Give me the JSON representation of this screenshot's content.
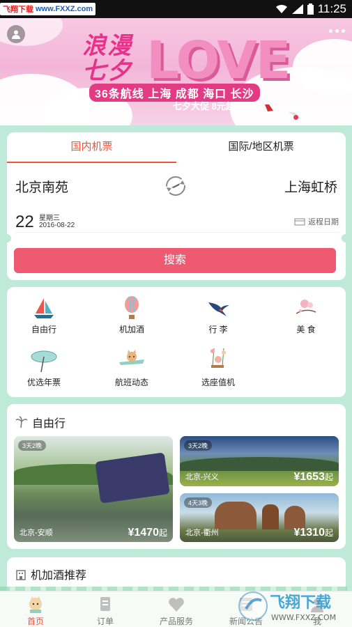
{
  "status_bar": {
    "site_left": "飞翔下载",
    "site_right": "www.FXXZ.com",
    "time": "11:25"
  },
  "banner": {
    "line1": "浪漫",
    "line2": "七夕",
    "big": "LOVE",
    "routes": "36条航线 上海 成都 海口 长沙",
    "promo": "七夕大促 8元起",
    "slide_count": 6,
    "active_slide": 0
  },
  "flight": {
    "tabs": [
      {
        "label": "国内机票",
        "active": true
      },
      {
        "label": "国际/地区机票",
        "active": false
      }
    ],
    "from": "北京南苑",
    "to": "上海虹桥",
    "day": "22",
    "weekday": "星期三",
    "date": "2016-08-22",
    "return_label": "返程日期",
    "search_label": "搜索"
  },
  "categories": [
    {
      "label": "自由行",
      "icon": "sailboat-icon"
    },
    {
      "label": "机加酒",
      "icon": "hot-air-balloon-icon"
    },
    {
      "label": "行 李",
      "icon": "swallow-icon"
    },
    {
      "label": "美 食",
      "icon": "flower-icon"
    },
    {
      "label": "优选年票",
      "icon": "umbrella-icon"
    },
    {
      "label": "航班动态",
      "icon": "plane-cat-icon"
    },
    {
      "label": "选座值机",
      "icon": "swing-icon"
    }
  ],
  "travel": {
    "title": "自由行",
    "tiles": [
      {
        "badge": "3天2晚",
        "city": "北京-安顺",
        "price": "¥1470",
        "suffix": "起"
      },
      {
        "badge": "3天2晚",
        "city": "北京-兴义",
        "price": "¥1653",
        "suffix": "起"
      },
      {
        "badge": "4天3晚",
        "city": "北京-衢州",
        "price": "¥1310",
        "suffix": "起"
      }
    ]
  },
  "hotel": {
    "title": "机加酒推荐"
  },
  "tabbar": [
    {
      "label": "首页",
      "icon": "home-icon",
      "active": true
    },
    {
      "label": "订单",
      "icon": "order-icon",
      "active": false
    },
    {
      "label": "产品服务",
      "icon": "heart-icon",
      "active": false
    },
    {
      "label": "新闻公告",
      "icon": "news-icon",
      "active": false
    },
    {
      "label": "我",
      "icon": "user-icon",
      "active": false
    }
  ],
  "watermark": {
    "text": "飞翔下载",
    "url": "WWW.FXXZ.COM"
  },
  "colors": {
    "accent": "#f0523a",
    "search_button": "#ef5a72",
    "page_bg": "#bfe9d8"
  }
}
